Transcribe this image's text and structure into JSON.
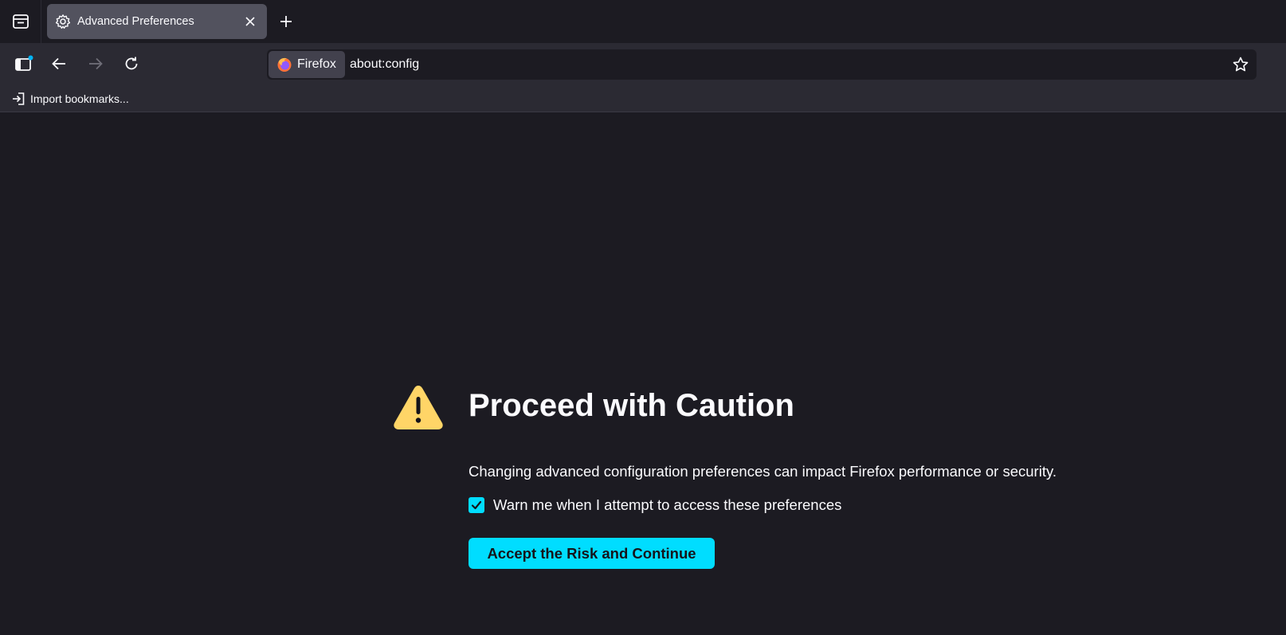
{
  "tabs": [
    {
      "title": "Advanced Preferences",
      "icon": "gear-icon",
      "active": true
    }
  ],
  "navbar": {
    "identity_label": "Firefox",
    "url": "about:config"
  },
  "bookmarks": {
    "import_label": "Import bookmarks..."
  },
  "warning_page": {
    "title": "Proceed with Caution",
    "description": "Changing advanced configuration preferences can impact Firefox performance or security.",
    "checkbox_label": "Warn me when I attempt to access these preferences",
    "checkbox_checked": true,
    "accept_button": "Accept the Risk and Continue"
  },
  "colors": {
    "accent": "#00ddff",
    "warning": "#ffd567",
    "background": "#1c1b22",
    "toolbar": "#2b2a33"
  }
}
